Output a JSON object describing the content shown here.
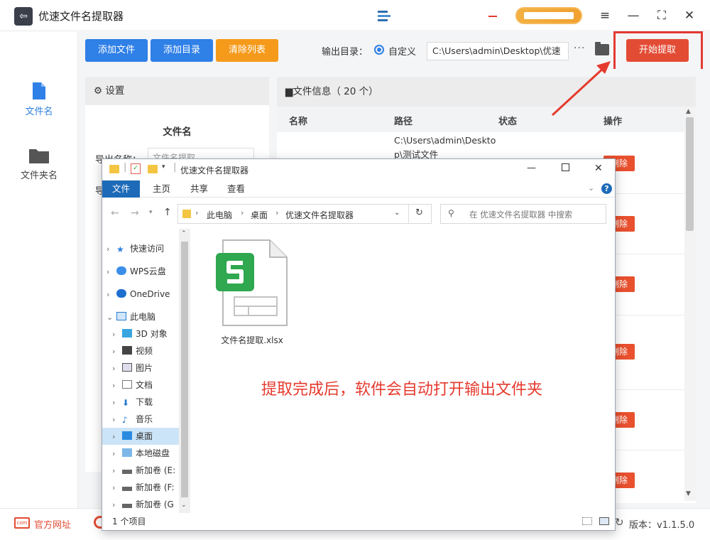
{
  "app": {
    "title": "优速文件名提取器"
  },
  "sidebar": {
    "items": [
      {
        "label": "文件名",
        "active": true
      },
      {
        "label": "文件夹名",
        "active": false
      }
    ]
  },
  "toolbar": {
    "add_file": "添加文件",
    "add_dir": "添加目录",
    "clear_list": "清除列表",
    "output_label": "输出目录：",
    "radio_label": "自定义",
    "output_path": "C:\\Users\\admin\\Desktop\\优速",
    "more": "···",
    "start": "开始提取"
  },
  "settings": {
    "title": "设置",
    "section": "文件名",
    "row1_label": "导出名称：",
    "row1_value": "文件名提取",
    "row2_label": "导"
  },
  "fileinfo": {
    "title": "文件信息（ 20 个）",
    "columns": [
      "名称",
      "路径",
      "状态",
      "操作"
    ],
    "first_path": "C:\\Users\\admin\\Desktop\\测试文件",
    "delete_label": "删除"
  },
  "footer": {
    "website": "官方网址",
    "version": "版本：v1.1.5.0"
  },
  "explorer": {
    "title": "优速文件名提取器",
    "tabs": [
      "文件",
      "主页",
      "共享",
      "查看"
    ],
    "breadcrumb": [
      "此电脑",
      "桌面",
      "优速文件名提取器"
    ],
    "search_placeholder": "在 优速文件名提取器 中搜索",
    "nav": [
      "快速访问",
      "WPS云盘",
      "OneDrive",
      "此电脑",
      "3D 对象",
      "视频",
      "图片",
      "文档",
      "下载",
      "音乐",
      "桌面",
      "本地磁盘",
      "新加卷 (E:",
      "新加卷 (F:",
      "新加卷 (G"
    ],
    "file_name": "文件名提取.xlsx",
    "status": "1 个项目"
  },
  "annotation": "提取完成后，软件会自动打开输出文件夹",
  "colors": {
    "accent_blue": "#2f80e7",
    "accent_orange": "#f59a1a",
    "accent_red": "#e34c34",
    "annotation_red": "#e53a2e"
  }
}
